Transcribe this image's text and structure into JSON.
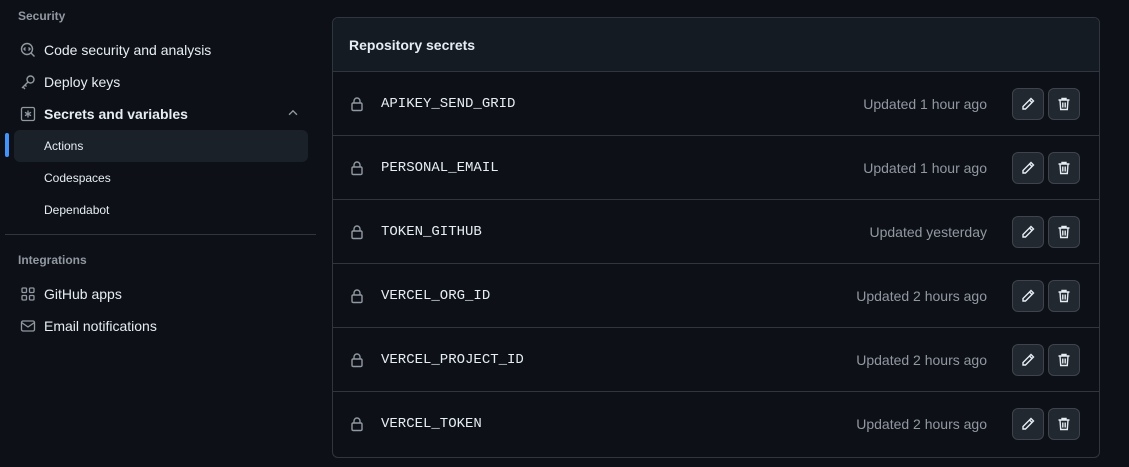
{
  "sidebar": {
    "security_heading": "Security",
    "security_items": [
      {
        "label": "Code security and analysis",
        "icon": "codescan-icon"
      },
      {
        "label": "Deploy keys",
        "icon": "key-icon"
      },
      {
        "label": "Secrets and variables",
        "icon": "asterisk-icon",
        "expanded": true
      }
    ],
    "secrets_subitems": [
      {
        "label": "Actions",
        "active": true
      },
      {
        "label": "Codespaces"
      },
      {
        "label": "Dependabot"
      }
    ],
    "integrations_heading": "Integrations",
    "integration_items": [
      {
        "label": "GitHub apps",
        "icon": "apps-icon"
      },
      {
        "label": "Email notifications",
        "icon": "mail-icon"
      }
    ]
  },
  "secrets_panel": {
    "title": "Repository secrets",
    "rows": [
      {
        "name": "APIKEY_SEND_GRID",
        "updated": "Updated 1 hour ago"
      },
      {
        "name": "PERSONAL_EMAIL",
        "updated": "Updated 1 hour ago"
      },
      {
        "name": "TOKEN_GITHUB",
        "updated": "Updated yesterday"
      },
      {
        "name": "VERCEL_ORG_ID",
        "updated": "Updated 2 hours ago"
      },
      {
        "name": "VERCEL_PROJECT_ID",
        "updated": "Updated 2 hours ago"
      },
      {
        "name": "VERCEL_TOKEN",
        "updated": "Updated 2 hours ago"
      }
    ]
  },
  "colors": {
    "background": "#0d1117",
    "panel_header": "#151b23",
    "border": "#30363d",
    "accent": "#4493f8",
    "muted_text": "#9198a1"
  }
}
